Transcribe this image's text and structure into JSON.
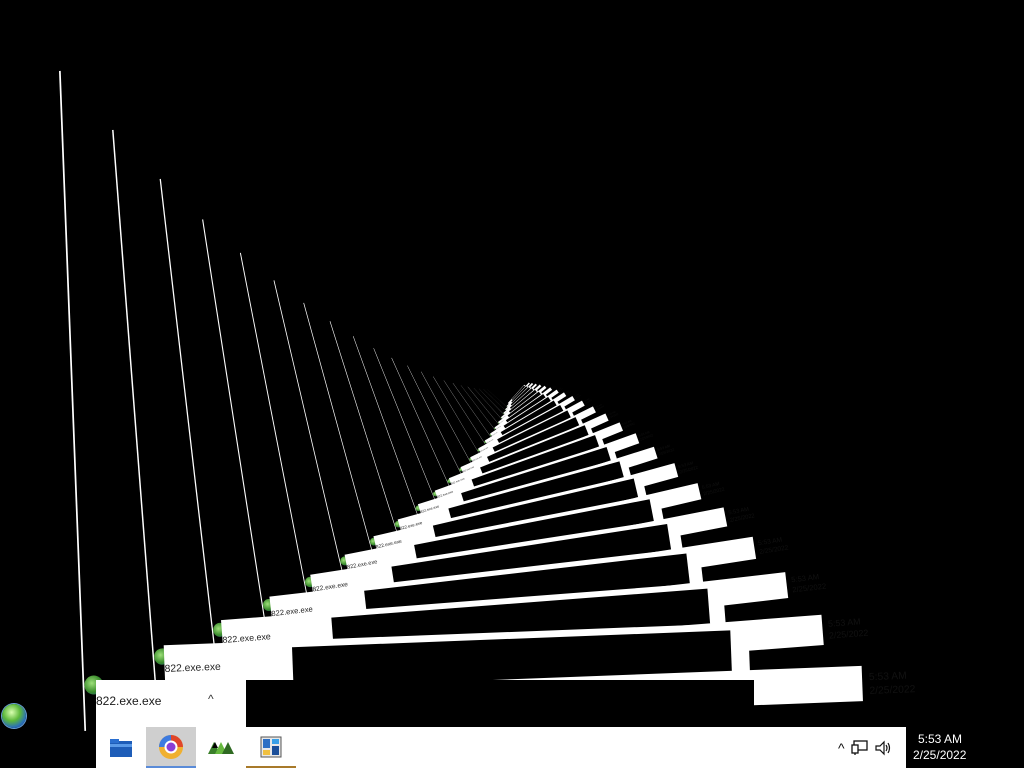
{
  "popup": {
    "title": "822.exe.exe",
    "chevron": "^"
  },
  "tray": {
    "chevron": "^",
    "network_icon": "network-icon",
    "volume_icon": "volume-icon"
  },
  "clock": {
    "time": "5:53 AM",
    "date": "2/25/2022"
  },
  "taskbar": {
    "items": [
      {
        "name": "file-explorer",
        "icon": "folder-icon"
      },
      {
        "name": "browser",
        "icon": "browser-icon"
      },
      {
        "name": "app-green-triangles",
        "icon": "triangles-icon"
      },
      {
        "name": "app-window-tiles",
        "icon": "tiles-icon"
      }
    ]
  },
  "desktop": {
    "orb_icon": "windows-orb-icon"
  }
}
